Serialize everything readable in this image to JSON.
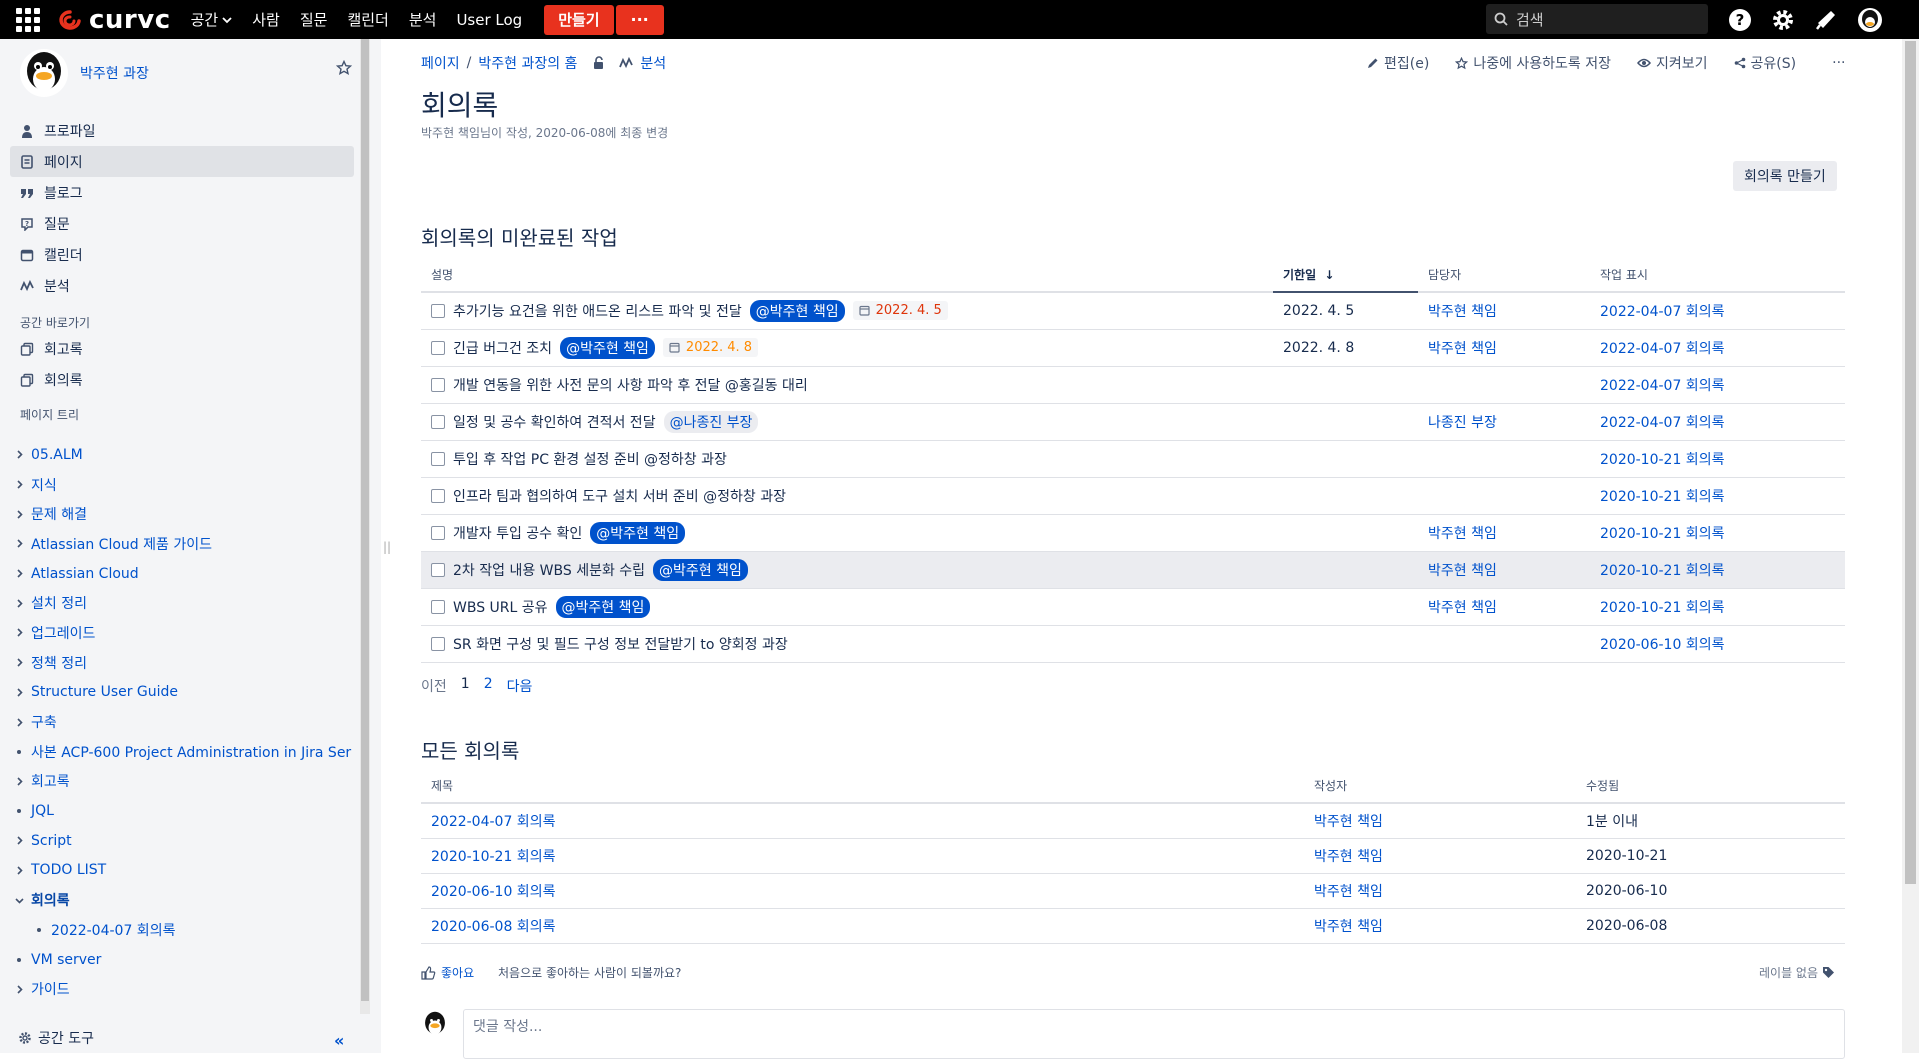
{
  "topnav": {
    "brand": "curvc",
    "items": [
      "공간",
      "사람",
      "질문",
      "캘린더",
      "분석",
      "User Log"
    ],
    "create_label": "만들기",
    "more_label": "···",
    "search_placeholder": "검색"
  },
  "sidebar": {
    "space_name": "박주현 과장",
    "nav": [
      {
        "label": "프로파일",
        "icon": "person-icon"
      },
      {
        "label": "페이지",
        "icon": "page-icon"
      },
      {
        "label": "블로그",
        "icon": "quote-icon"
      },
      {
        "label": "질문",
        "icon": "question-icon"
      },
      {
        "label": "캘린더",
        "icon": "calendar-icon"
      },
      {
        "label": "분석",
        "icon": "analytics-icon"
      }
    ],
    "shortcuts_heading": "공간 바로가기",
    "shortcuts": [
      "회고록",
      "회의록"
    ],
    "tree_heading": "페이지 트리",
    "tree": [
      {
        "label": "05.ALM",
        "type": "chevron"
      },
      {
        "label": "지식",
        "type": "chevron"
      },
      {
        "label": "문제 해결",
        "type": "chevron"
      },
      {
        "label": "Atlassian Cloud 제품 가이드",
        "type": "chevron"
      },
      {
        "label": "Atlassian Cloud",
        "type": "chevron"
      },
      {
        "label": "설치 정리",
        "type": "chevron"
      },
      {
        "label": "업그레이드",
        "type": "chevron"
      },
      {
        "label": "정책 정리",
        "type": "chevron"
      },
      {
        "label": "Structure User Guide",
        "type": "chevron"
      },
      {
        "label": "구축",
        "type": "chevron"
      },
      {
        "label": "사본 ACP-600 Project Administration in Jira Ser",
        "type": "bullet"
      },
      {
        "label": "회고록",
        "type": "chevron"
      },
      {
        "label": "JQL",
        "type": "bullet"
      },
      {
        "label": "Script",
        "type": "chevron"
      },
      {
        "label": "TODO LIST",
        "type": "chevron"
      },
      {
        "label": "회의록",
        "type": "open"
      },
      {
        "label": "2022-04-07 회의록",
        "type": "subbullet"
      },
      {
        "label": "VM server",
        "type": "bullet"
      },
      {
        "label": "가이드",
        "type": "chevron"
      }
    ],
    "footer_label": "공간 도구",
    "collapse_label": "«"
  },
  "page": {
    "breadcrumbs": [
      "페이지",
      "/",
      "박주현 과장의 홈"
    ],
    "analytics_label": "분석",
    "actions": {
      "edit": "편집(e)",
      "save_later": "나중에 사용하도록 저장",
      "watch": "지켜보기",
      "share": "공유(S)",
      "more": "···"
    },
    "title": "회의록",
    "byline": "박주현 책임님이 작성, 2020-06-08에 최종 변경",
    "create_button": "회의록 만들기",
    "tasks_heading": "회의록의 미완료된 작업",
    "task_columns": [
      "설명",
      "기한일",
      "담당자",
      "작업 표시"
    ],
    "tasks": [
      {
        "desc": "추가기능 요건을 위한 애드온 리스트 파악 및 전달",
        "mention": "@박주현 책임",
        "mention_style": "dark",
        "lozenge": "2022. 4. 5",
        "lozenge_color": "red",
        "due": "2022. 4. 5",
        "assignee": "박주현 책임",
        "page": "2022-04-07 회의록"
      },
      {
        "desc": "긴급 버그건 조치",
        "mention": "@박주현 책임",
        "mention_style": "dark",
        "lozenge": "2022. 4. 8",
        "lozenge_color": "orange",
        "due": "2022. 4. 8",
        "assignee": "박주현 책임",
        "page": "2022-04-07 회의록"
      },
      {
        "desc": "개발 연동을 위한 사전 문의 사항 파악 후 전달 @홍길동 대리",
        "mention": "",
        "mention_style": "",
        "lozenge": "",
        "lozenge_color": "",
        "due": "",
        "assignee": "",
        "page": "2022-04-07 회의록"
      },
      {
        "desc": "일정 및 공수 확인하여 견적서 전달",
        "mention": "@나종진 부장",
        "mention_style": "light",
        "lozenge": "",
        "lozenge_color": "",
        "due": "",
        "assignee": "나종진 부장",
        "page": "2022-04-07 회의록"
      },
      {
        "desc": "투입 후 작업 PC 환경 설정 준비 @정하창 과장",
        "mention": "",
        "mention_style": "",
        "lozenge": "",
        "lozenge_color": "",
        "due": "",
        "assignee": "",
        "page": "2020-10-21 회의록"
      },
      {
        "desc": "인프라 팀과 협의하여 도구 설치 서버 준비 @정하창 과장",
        "mention": "",
        "mention_style": "",
        "lozenge": "",
        "lozenge_color": "",
        "due": "",
        "assignee": "",
        "page": "2020-10-21 회의록"
      },
      {
        "desc": "개발자 투입 공수 확인",
        "mention": "@박주현 책임",
        "mention_style": "dark",
        "lozenge": "",
        "lozenge_color": "",
        "due": "",
        "assignee": "박주현 책임",
        "page": "2020-10-21 회의록"
      },
      {
        "desc": "2차 작업 내용 WBS 세분화 수립",
        "mention": "@박주현 책임",
        "mention_style": "dark",
        "lozenge": "",
        "lozenge_color": "",
        "due": "",
        "assignee": "박주현 책임",
        "page": "2020-10-21 회의록"
      },
      {
        "desc": "WBS URL 공유",
        "mention": "@박주현 책임",
        "mention_style": "dark",
        "lozenge": "",
        "lozenge_color": "",
        "due": "",
        "assignee": "박주현 책임",
        "page": "2020-10-21 회의록"
      },
      {
        "desc": "SR 화면 구성 및 필드 구성 정보 전달받기 to 양회정 과장",
        "mention": "",
        "mention_style": "",
        "lozenge": "",
        "lozenge_color": "",
        "due": "",
        "assignee": "",
        "page": "2020-06-10 회의록"
      }
    ],
    "pager": {
      "prev": "이전",
      "pages": [
        "1",
        "2"
      ],
      "next": "다음"
    },
    "meetings_heading": "모든 회의록",
    "meeting_columns": [
      "제목",
      "작성자",
      "수정됨"
    ],
    "meetings": [
      {
        "title": "2022-04-07 회의록",
        "author": "박주현 책임",
        "modified": "1분 이내"
      },
      {
        "title": "2020-10-21 회의록",
        "author": "박주현 책임",
        "modified": "2020-10-21"
      },
      {
        "title": "2020-06-10 회의록",
        "author": "박주현 책임",
        "modified": "2020-06-10"
      },
      {
        "title": "2020-06-08 회의록",
        "author": "박주현 책임",
        "modified": "2020-06-08"
      }
    ],
    "like_label": "좋아요",
    "like_hint": "처음으로 좋아하는 사람이 되볼까요?",
    "labels_label": "레이블 없음",
    "comment_placeholder": "댓글 작성..."
  },
  "colors": {
    "topbar": "#000000",
    "create": "#e8321e",
    "link": "#0052cc",
    "mention": "#0052cc"
  }
}
